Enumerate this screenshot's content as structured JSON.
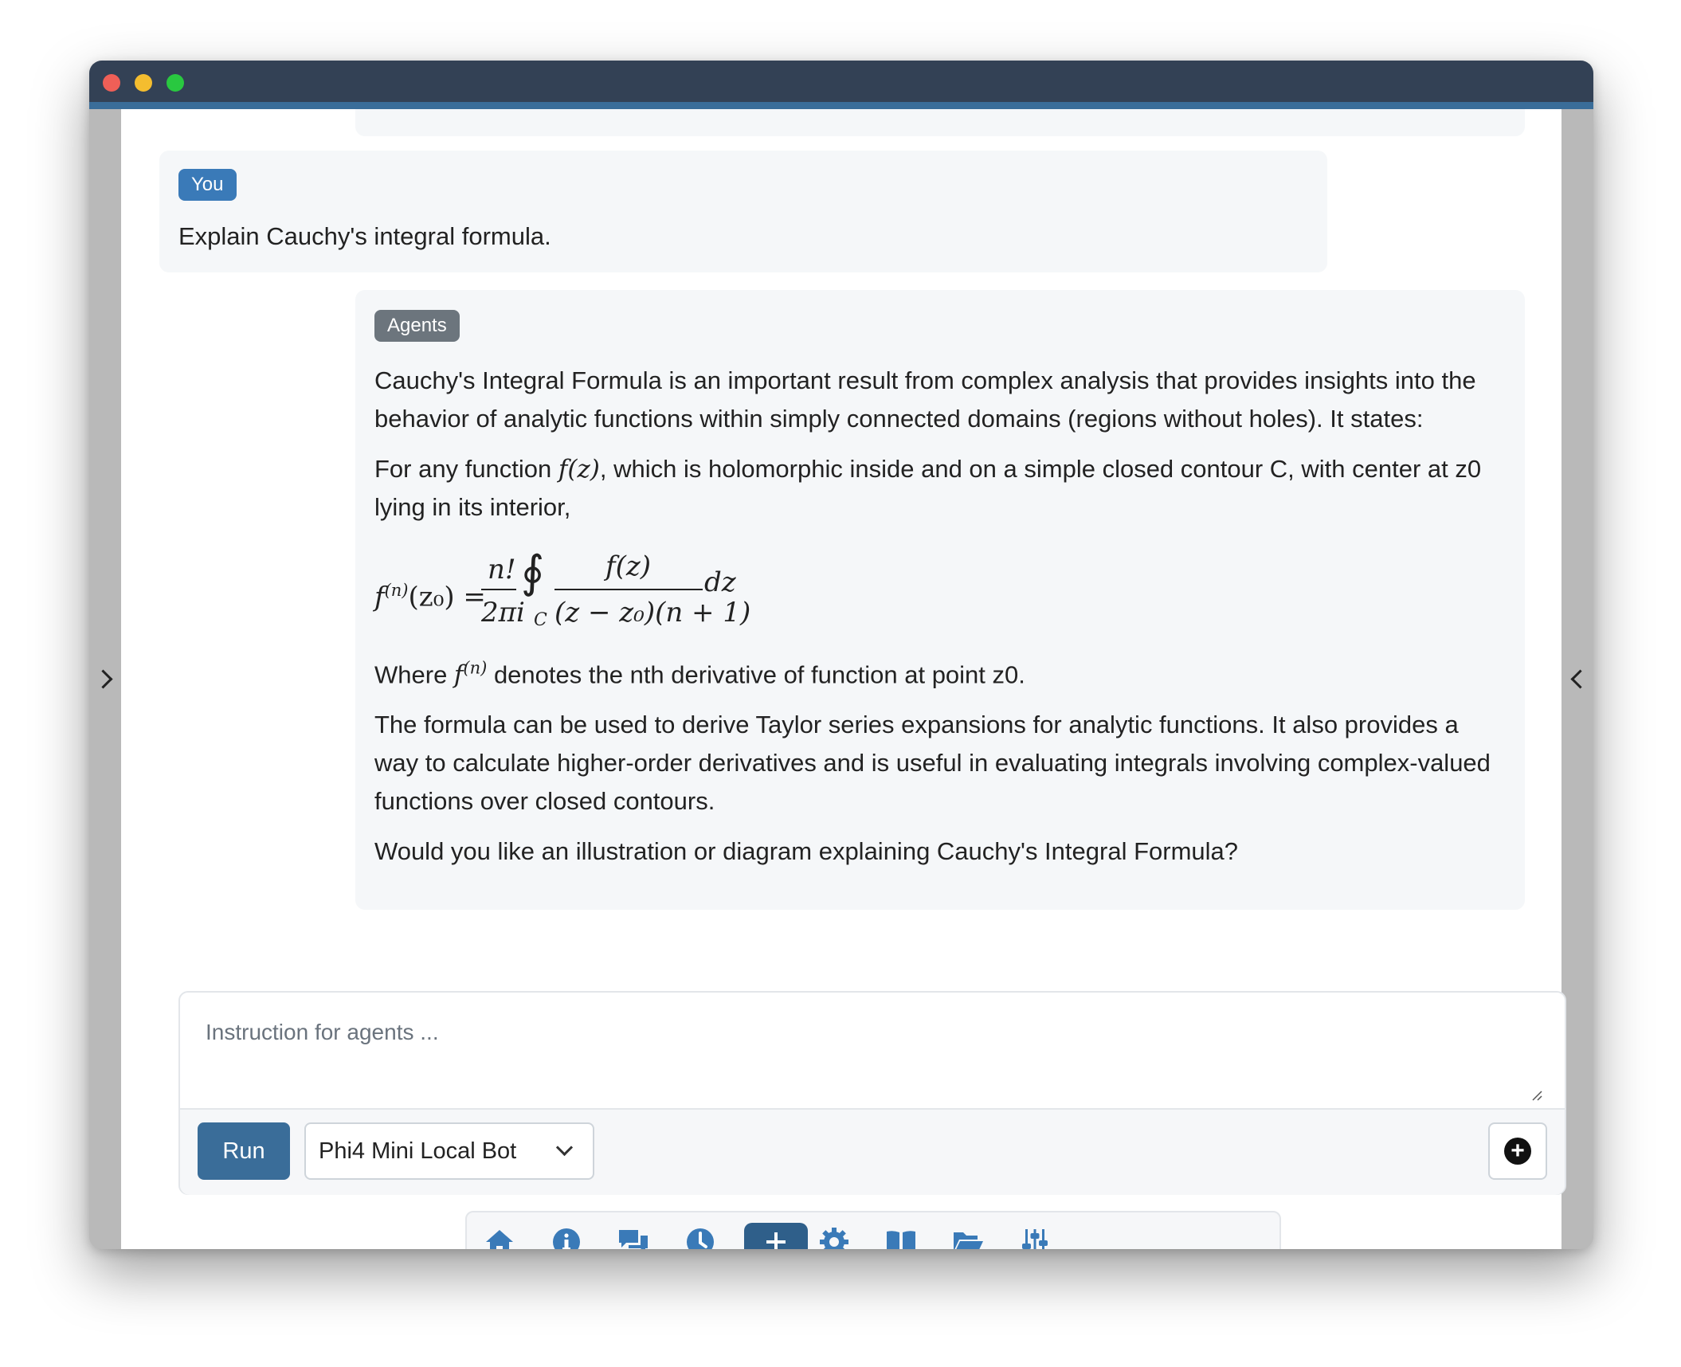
{
  "window": {
    "traffic_lights": [
      "close",
      "minimize",
      "maximize"
    ]
  },
  "chat": {
    "user_message": {
      "badge": "You",
      "text": "Explain Cauchy's integral formula."
    },
    "agent_message": {
      "badge": "Agents",
      "paragraph1": "Cauchy's Integral Formula is an important result from complex analysis that provides insights into the behavior of analytic functions within simply connected domains (regions without holes). It states:",
      "paragraph2_pre": "For any function ",
      "paragraph2_post": ", which is holomorphic inside and on a simple closed contour C, with center at z0 lying in its interior,",
      "paragraph3_pre": "Where ",
      "paragraph3_post": " denotes the nth derivative of function at point z0.",
      "paragraph4": "The formula can be used to derive Taylor series expansions for analytic functions. It also provides a way to calculate higher-order derivatives and is useful in evaluating integrals involving complex-valued functions over closed contours.",
      "paragraph5": "Would you like an illustration or diagram explaining Cauchy's Integral Formula?",
      "math": {
        "inline_fz": "f(z)",
        "inline_fn": "f",
        "inline_fn_sup": "(n)",
        "lhs": "f",
        "lhs_sup": "(n)",
        "lhs_arg": "(z₀) =",
        "frac1_num": "n!",
        "frac1_den": "2πi",
        "integral": "∮",
        "integral_sub": "C",
        "frac2_num": "f(z)",
        "frac2_den": "(z − z₀)(n + 1)",
        "tail": "dz"
      }
    }
  },
  "composer": {
    "placeholder": "Instruction for agents ...",
    "value": "",
    "run_label": "Run",
    "selected_model": "Phi4 Mini Local Bot"
  },
  "toolbar": {
    "items": [
      "home-icon",
      "info-icon",
      "chat-icon",
      "history-icon",
      "add-icon",
      "settings-icon",
      "book-icon",
      "folder-open-icon",
      "sliders-icon"
    ],
    "active": "add-icon"
  },
  "colors": {
    "titlebar": "#334155",
    "accent": "#3a6d99",
    "icon": "#3a7ab8",
    "message_bg": "#f5f7f9"
  }
}
